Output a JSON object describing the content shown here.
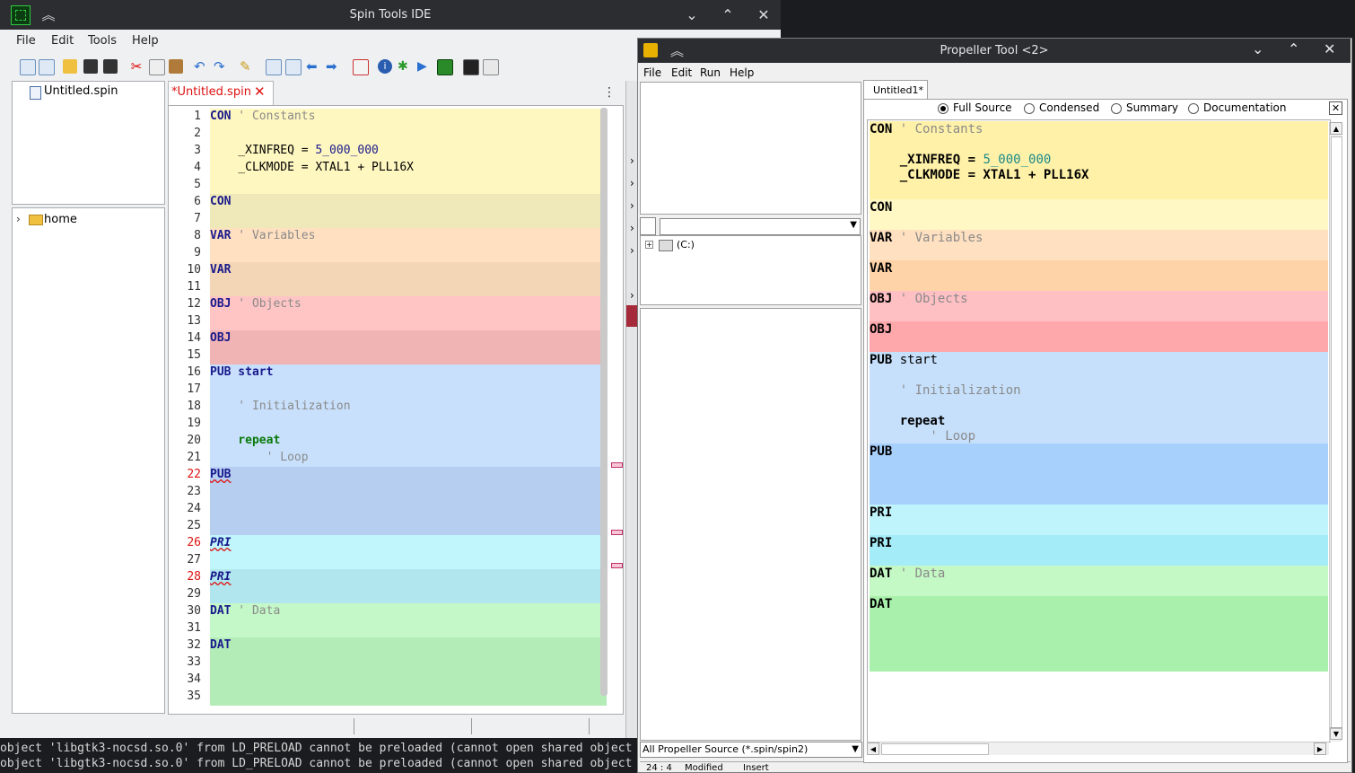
{
  "terminal": {
    "lines": [
      "object 'libgtk3-nocsd.so.0' from LD_PRELOAD cannot be preloaded (cannot open shared object",
      "object 'libgtk3-nocsd.so.0' from LD_PRELOAD cannot be preloaded (cannot open shared object"
    ],
    "gutter_chars": [
      "a",
      "a",
      "a",
      "a",
      "a",
      "a",
      "o",
      "o"
    ]
  },
  "ide": {
    "title": "Spin Tools IDE",
    "menu": [
      "File",
      "Edit",
      "Tools",
      "Help"
    ],
    "file_tree": {
      "file": "Untitled.spin",
      "folder": "home"
    },
    "tab_label": "*Untitled.spin",
    "lines": [
      {
        "n": "1",
        "parts": [
          [
            "kw",
            "CON"
          ],
          [
            "cm",
            " ' Constants"
          ]
        ]
      },
      {
        "n": "2",
        "parts": []
      },
      {
        "n": "3",
        "parts": [
          [
            "plain",
            "    _XINFREQ = "
          ],
          [
            "num",
            "5_000_000"
          ]
        ]
      },
      {
        "n": "4",
        "parts": [
          [
            "plain",
            "    _CLKMODE = XTAL1 + PLL16X"
          ]
        ]
      },
      {
        "n": "5",
        "parts": []
      },
      {
        "n": "6",
        "parts": [
          [
            "kw",
            "CON"
          ]
        ]
      },
      {
        "n": "7",
        "parts": []
      },
      {
        "n": "8",
        "parts": [
          [
            "kw",
            "VAR"
          ],
          [
            "cm",
            " ' Variables"
          ]
        ]
      },
      {
        "n": "9",
        "parts": []
      },
      {
        "n": "10",
        "parts": [
          [
            "kw",
            "VAR"
          ]
        ]
      },
      {
        "n": "11",
        "parts": []
      },
      {
        "n": "12",
        "parts": [
          [
            "kw",
            "OBJ"
          ],
          [
            "cm",
            " ' Objects"
          ]
        ]
      },
      {
        "n": "13",
        "parts": []
      },
      {
        "n": "14",
        "parts": [
          [
            "kw",
            "OBJ"
          ]
        ]
      },
      {
        "n": "15",
        "parts": []
      },
      {
        "n": "16",
        "parts": [
          [
            "kw",
            "PUB start"
          ]
        ]
      },
      {
        "n": "17",
        "parts": []
      },
      {
        "n": "18",
        "parts": [
          [
            "cm",
            "    ' Initialization"
          ]
        ]
      },
      {
        "n": "19",
        "parts": []
      },
      {
        "n": "20",
        "parts": [
          [
            "green",
            "    repeat"
          ]
        ]
      },
      {
        "n": "21",
        "parts": [
          [
            "cm",
            "        ' Loop"
          ]
        ]
      },
      {
        "n": "22",
        "parts": [
          [
            "kw",
            "PUB"
          ]
        ],
        "err": true
      },
      {
        "n": "23",
        "parts": []
      },
      {
        "n": "24",
        "parts": []
      },
      {
        "n": "25",
        "parts": []
      },
      {
        "n": "26",
        "parts": [
          [
            "kw",
            "PRI"
          ]
        ],
        "err": true
      },
      {
        "n": "27",
        "parts": []
      },
      {
        "n": "28",
        "parts": [
          [
            "kw",
            "PRI"
          ]
        ],
        "err": true
      },
      {
        "n": "29",
        "parts": []
      },
      {
        "n": "30",
        "parts": [
          [
            "kw",
            "DAT"
          ],
          [
            "cm",
            " ' Data"
          ]
        ]
      },
      {
        "n": "31",
        "parts": []
      },
      {
        "n": "32",
        "parts": [
          [
            "kw",
            "DAT"
          ]
        ]
      },
      {
        "n": "33",
        "parts": []
      },
      {
        "n": "34",
        "parts": []
      },
      {
        "n": "35",
        "parts": []
      }
    ],
    "row_colors": [
      "#fff7c0",
      "#fff7c0",
      "#fff7c0",
      "#fff7c0",
      "#fff7c0",
      "#efe8b8",
      "#efe8b8",
      "#ffe0c0",
      "#ffe0c0",
      "#f2d6b6",
      "#f2d6b6",
      "#ffc4c4",
      "#ffc4c4",
      "#f0b4b4",
      "#f0b4b4",
      "#c8e0fc",
      "#c8e0fc",
      "#c8e0fc",
      "#c8e0fc",
      "#c8e0fc",
      "#c8e0fc",
      "#b6cff0",
      "#b6cff0",
      "#b6cff0",
      "#b6cff0",
      "#c0f6fc",
      "#c0f6fc",
      "#b2e6ee",
      "#b2e6ee",
      "#c4f8c8",
      "#c4f8c8",
      "#b4ecb8",
      "#b4ecb8",
      "#b4ecb8",
      "#b4ecb8"
    ]
  },
  "propeller": {
    "title": "Propeller Tool <2>",
    "menu": [
      "File",
      "Edit",
      "Run",
      "Help"
    ],
    "drive": "(C:)",
    "filter": "All Propeller Source (*.spin/spin2)",
    "status": [
      "24 : 4",
      "Modified",
      "Insert"
    ],
    "tab": "Untitled1*",
    "view_options": [
      "Full Source",
      "Condensed",
      "Summary",
      "Documentation"
    ],
    "selected_view": "Full Source",
    "blocks": [
      {
        "bg": "#fff1a8",
        "h": 87,
        "lines": [
          [
            [
              "ptkw",
              "CON"
            ],
            [
              "ptcm",
              " ' Constants"
            ]
          ],
          [],
          [
            [
              "ptkw",
              "    _XINFREQ = "
            ],
            [
              "ptnum",
              "5_000_000"
            ]
          ],
          [
            [
              "ptkw",
              "    _CLKMODE = XTAL1 + PLL16X"
            ]
          ]
        ]
      },
      {
        "bg": "#fff8c4",
        "h": 34,
        "lines": [
          [
            [
              "ptkw",
              "CON"
            ]
          ]
        ]
      },
      {
        "bg": "#ffe0c0",
        "h": 34,
        "lines": [
          [
            [
              "ptkw",
              "VAR"
            ],
            [
              "ptcm",
              " ' Variables"
            ]
          ]
        ]
      },
      {
        "bg": "#ffd3a8",
        "h": 34,
        "lines": [
          [
            [
              "ptkw",
              "VAR"
            ]
          ]
        ]
      },
      {
        "bg": "#ffc0c4",
        "h": 34,
        "lines": [
          [
            [
              "ptkw",
              "OBJ"
            ],
            [
              "ptcm",
              " ' Objects"
            ]
          ]
        ]
      },
      {
        "bg": "#ffa8ac",
        "h": 34,
        "lines": [
          [
            [
              "ptkw",
              "OBJ"
            ]
          ]
        ]
      },
      {
        "bg": "#c6e0fc",
        "h": 102,
        "lines": [
          [
            [
              "ptkw",
              "PUB"
            ],
            [
              "plain",
              " start"
            ]
          ],
          [],
          [
            [
              "ptcm",
              "    ' Initialization"
            ]
          ],
          [],
          [
            [
              "ptkw",
              "    repeat"
            ]
          ],
          [
            [
              "ptcm",
              "        ' Loop"
            ]
          ]
        ]
      },
      {
        "bg": "#a8d0fc",
        "h": 68,
        "lines": [
          [
            [
              "ptkw",
              "PUB"
            ]
          ]
        ]
      },
      {
        "bg": "#c0f4fc",
        "h": 34,
        "lines": [
          [
            [
              "ptkw",
              "PRI"
            ]
          ]
        ]
      },
      {
        "bg": "#a4ecf8",
        "h": 34,
        "lines": [
          [
            [
              "ptkw",
              "PRI"
            ]
          ]
        ]
      },
      {
        "bg": "#c4f8c4",
        "h": 34,
        "lines": [
          [
            [
              "ptkw",
              "DAT"
            ],
            [
              "ptcm",
              " ' Data"
            ]
          ]
        ]
      },
      {
        "bg": "#a8f0ac",
        "h": 84,
        "lines": [
          [
            [
              "ptkw",
              "DAT"
            ]
          ]
        ]
      }
    ]
  }
}
